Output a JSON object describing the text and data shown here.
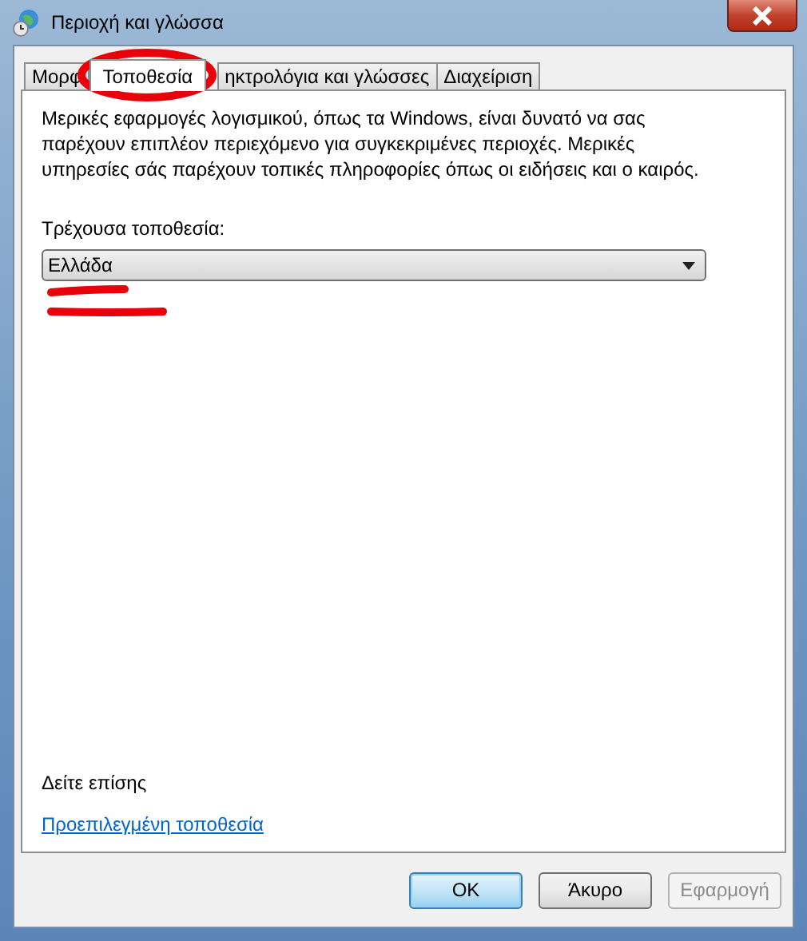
{
  "window": {
    "title": "Περιοχή και γλώσσα"
  },
  "tabs": [
    {
      "label": "Μορφ",
      "selected": false
    },
    {
      "label": "Τοποθεσία",
      "selected": true
    },
    {
      "label": "ηκτρολόγια και γλώσσες",
      "selected": false
    },
    {
      "label": "Διαχείριση",
      "selected": false
    }
  ],
  "description": "Μερικές εφαρμογές λογισμικού, όπως τα Windows, είναι δυνατό να σας παρέχουν επιπλέον περιεχόμενο για συγκεκριμένες περιοχές. Μερικές υπηρεσίες σάς παρέχουν τοπικές πληροφορίες όπως οι ειδήσεις και ο καιρός.",
  "current_location": {
    "label": "Τρέχουσα τοποθεσία:",
    "value": "Ελλάδα"
  },
  "see_also": {
    "heading": "Δείτε επίσης",
    "link": "Προεπιλεγμένη τοποθεσία"
  },
  "buttons": [
    {
      "label": "OK",
      "default": true,
      "disabled": false
    },
    {
      "label": "Άκυρο",
      "default": false,
      "disabled": false
    },
    {
      "label": "Εφαρμογή",
      "default": false,
      "disabled": true
    }
  ]
}
